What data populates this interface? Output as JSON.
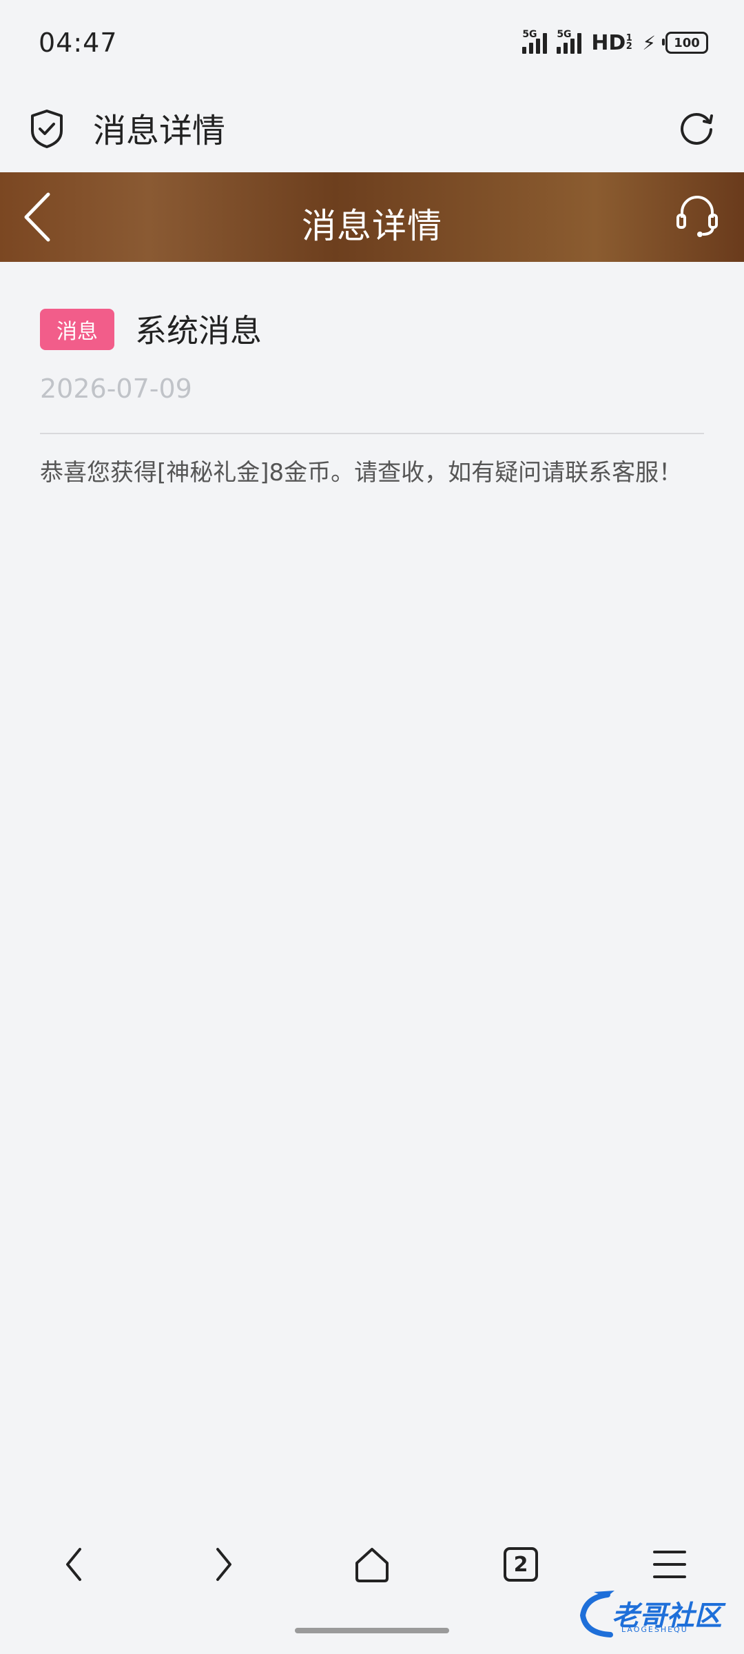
{
  "status_bar": {
    "time": "04:47",
    "network1": "5G",
    "network2": "5G",
    "hd_label": "HD",
    "battery": "100"
  },
  "browser": {
    "title": "消息详情"
  },
  "page_header": {
    "title": "消息详情"
  },
  "message": {
    "tag": "消息",
    "title": "系统消息",
    "date": "2026-07-09",
    "body": "恭喜您获得[神秘礼金]8金币。请查收，如有疑问请联系客服！"
  },
  "bottom_nav": {
    "tab_count": "2"
  },
  "watermark": {
    "text": "老哥社区",
    "subtext": "LAOGESHEQU"
  },
  "colors": {
    "banner": "#7b4722",
    "tag": "#f25d8a",
    "background": "#f3f4f6"
  }
}
